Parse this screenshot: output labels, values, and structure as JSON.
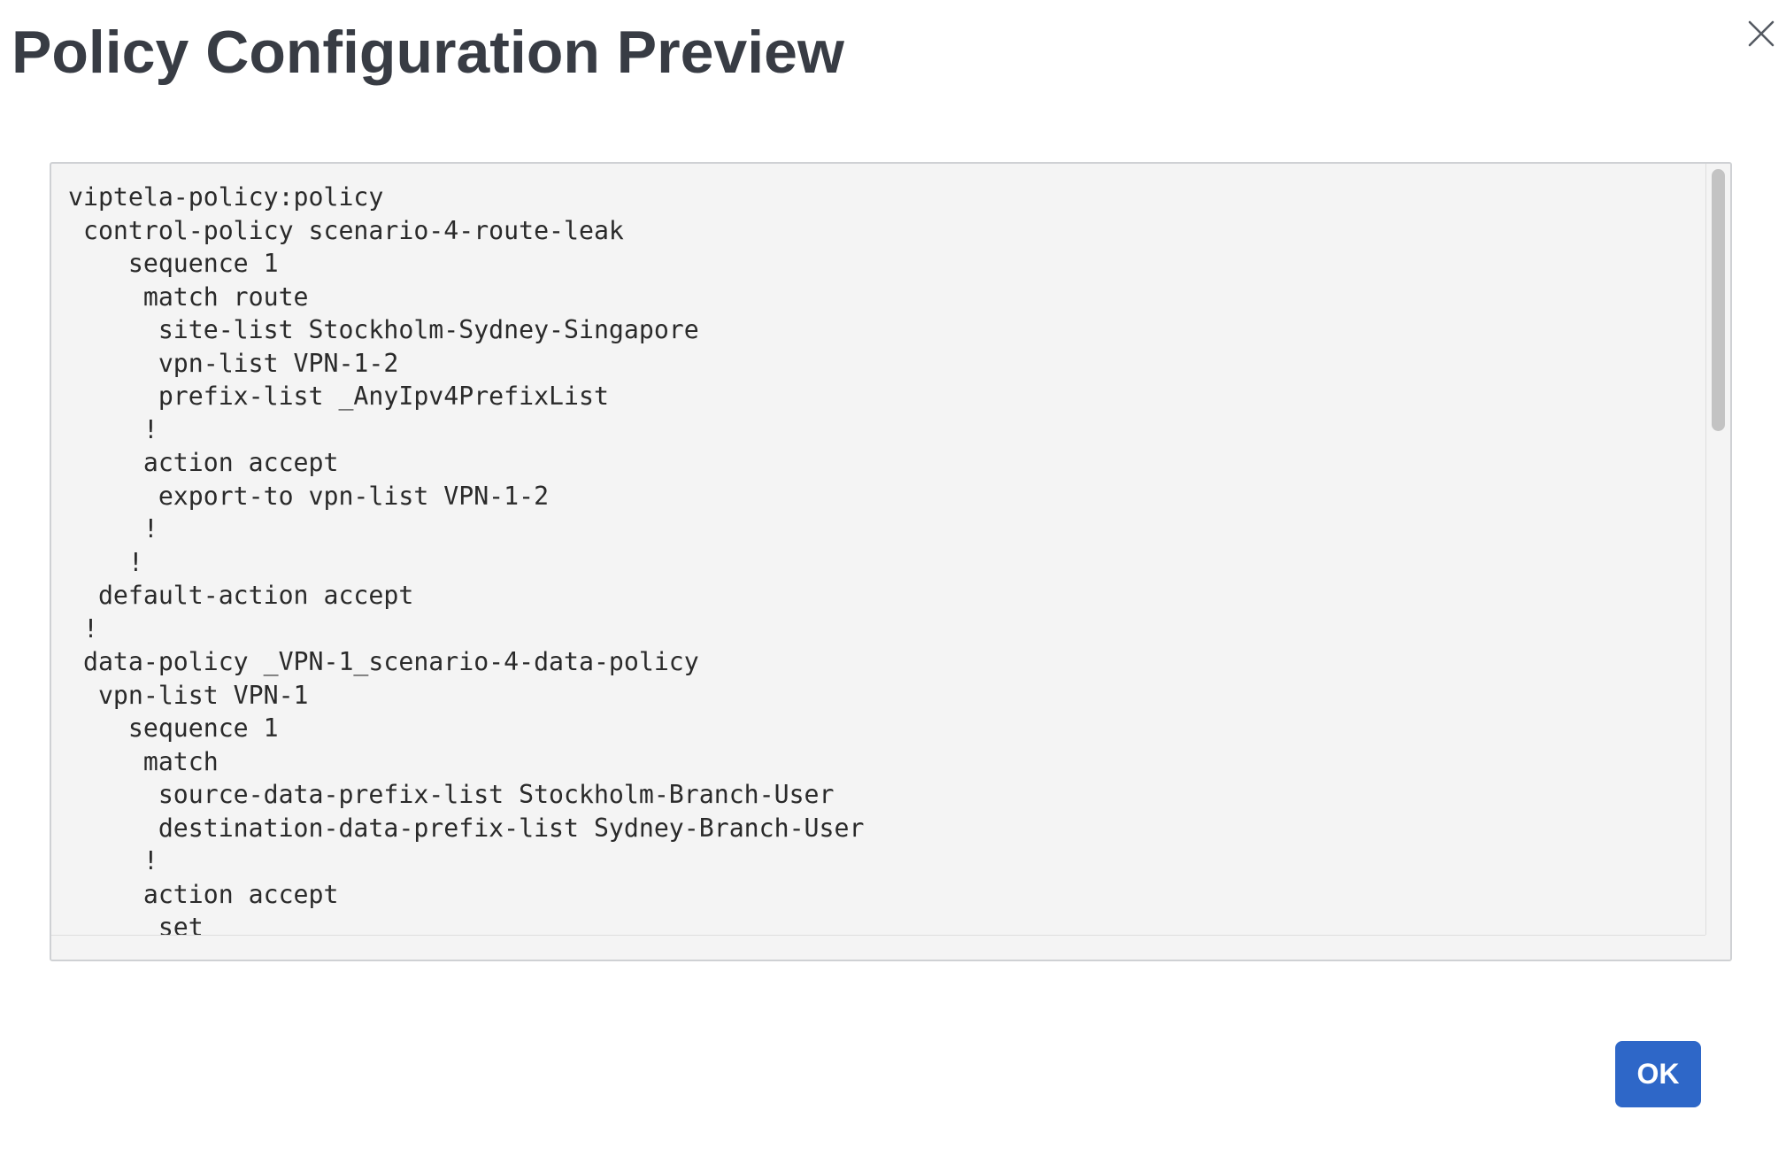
{
  "modal": {
    "title": "Policy Configuration Preview",
    "close_icon": "close-icon",
    "ok_label": "OK",
    "accent_color": "#2e67c8"
  },
  "preview": {
    "lines": [
      "viptela-policy:policy",
      " control-policy scenario-4-route-leak",
      "    sequence 1",
      "     match route",
      "      site-list Stockholm-Sydney-Singapore",
      "      vpn-list VPN-1-2",
      "      prefix-list _AnyIpv4PrefixList",
      "     !",
      "     action accept",
      "      export-to vpn-list VPN-1-2",
      "     !",
      "    !",
      "  default-action accept",
      " !",
      " data-policy _VPN-1_scenario-4-data-policy",
      "  vpn-list VPN-1",
      "    sequence 1",
      "     match",
      "      source-data-prefix-list Stockholm-Branch-User",
      "      destination-data-prefix-list Sydney-Branch-User",
      "     !",
      "     action accept",
      "      set"
    ]
  }
}
